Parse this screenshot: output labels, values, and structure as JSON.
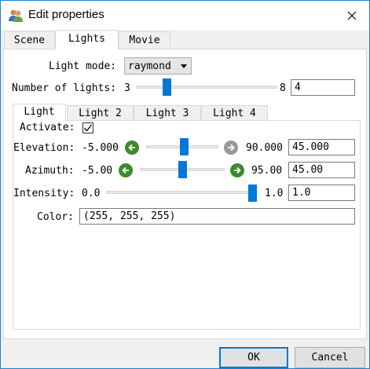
{
  "window": {
    "title": "Edit properties",
    "app_icon": "users-icon",
    "close_icon": "close-icon"
  },
  "tabs": [
    {
      "label": "Scene",
      "active": false
    },
    {
      "label": "Lights",
      "active": true
    },
    {
      "label": "Movie",
      "active": false
    }
  ],
  "lights": {
    "mode_label": "Light mode:",
    "mode_value": "raymond",
    "count_label": "Number of lights:",
    "count_min": "3",
    "count_max": "8",
    "count_value": "4",
    "count_slider_fraction": 0.2
  },
  "subtabs": [
    {
      "label": "Light",
      "active": true
    },
    {
      "label": "Light 2",
      "active": false
    },
    {
      "label": "Light 3",
      "active": false
    },
    {
      "label": "Light 4",
      "active": false
    }
  ],
  "light": {
    "activate_label": "Activate:",
    "activate_checked": true,
    "elevation": {
      "label": "Elevation:",
      "min": "-5.000",
      "max": "90.000",
      "value": "45.000",
      "fraction": 0.526
    },
    "azimuth": {
      "label": "Azimuth:",
      "min": "-5.00",
      "max": "95.00",
      "value": "45.00",
      "fraction": 0.5
    },
    "intensity": {
      "label": "Intensity:",
      "min": "0.0",
      "max": "1.0",
      "value": "1.0",
      "fraction": 1.0
    },
    "color_label": "Color:",
    "color_value": "(255, 255, 255)"
  },
  "buttons": {
    "ok": "OK",
    "cancel": "Cancel"
  },
  "colors": {
    "accent": "#0078d7",
    "arrow_green": "#3c8a2e",
    "arrow_gray": "#9a9a9a"
  }
}
